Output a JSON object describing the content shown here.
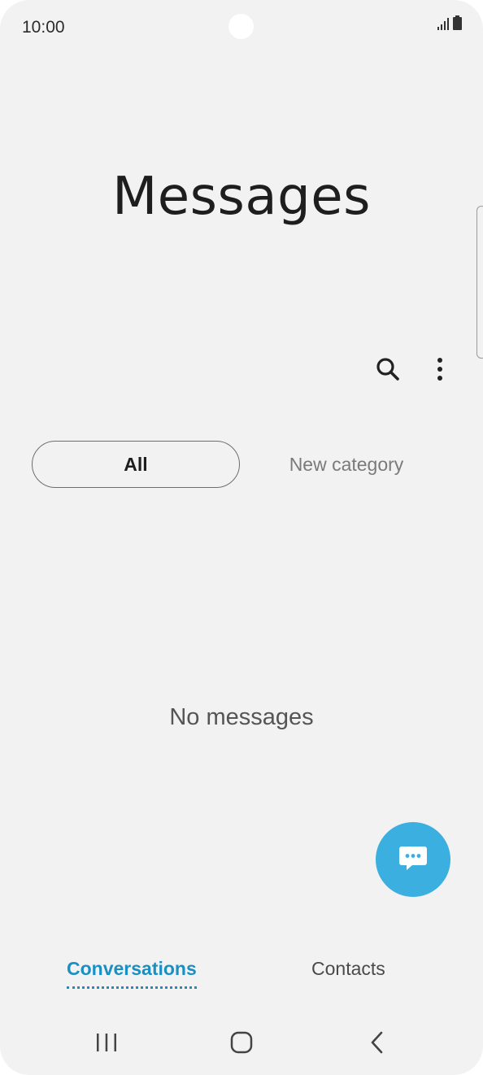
{
  "status_bar": {
    "time": "10:00",
    "signal_icon": "signal-bars-icon",
    "battery_icon": "battery-icon"
  },
  "header": {
    "title": "Messages"
  },
  "toolbar": {
    "search_icon": "search-icon",
    "more_icon": "more-vert-icon"
  },
  "category_tabs": [
    {
      "label": "All",
      "selected": true
    },
    {
      "label": "New category",
      "selected": false
    }
  ],
  "main": {
    "empty_text": "No messages"
  },
  "fab": {
    "icon": "compose-message-icon",
    "color": "#3aafe0"
  },
  "bottom_tabs": [
    {
      "label": "Conversations",
      "selected": true
    },
    {
      "label": "Contacts",
      "selected": false
    }
  ],
  "nav_bar": {
    "recents_icon": "recents-icon",
    "home_icon": "home-icon",
    "back_icon": "back-icon"
  },
  "colors": {
    "background": "#f2f2f2",
    "accent": "#1a8fc4",
    "fab": "#3aafe0"
  }
}
